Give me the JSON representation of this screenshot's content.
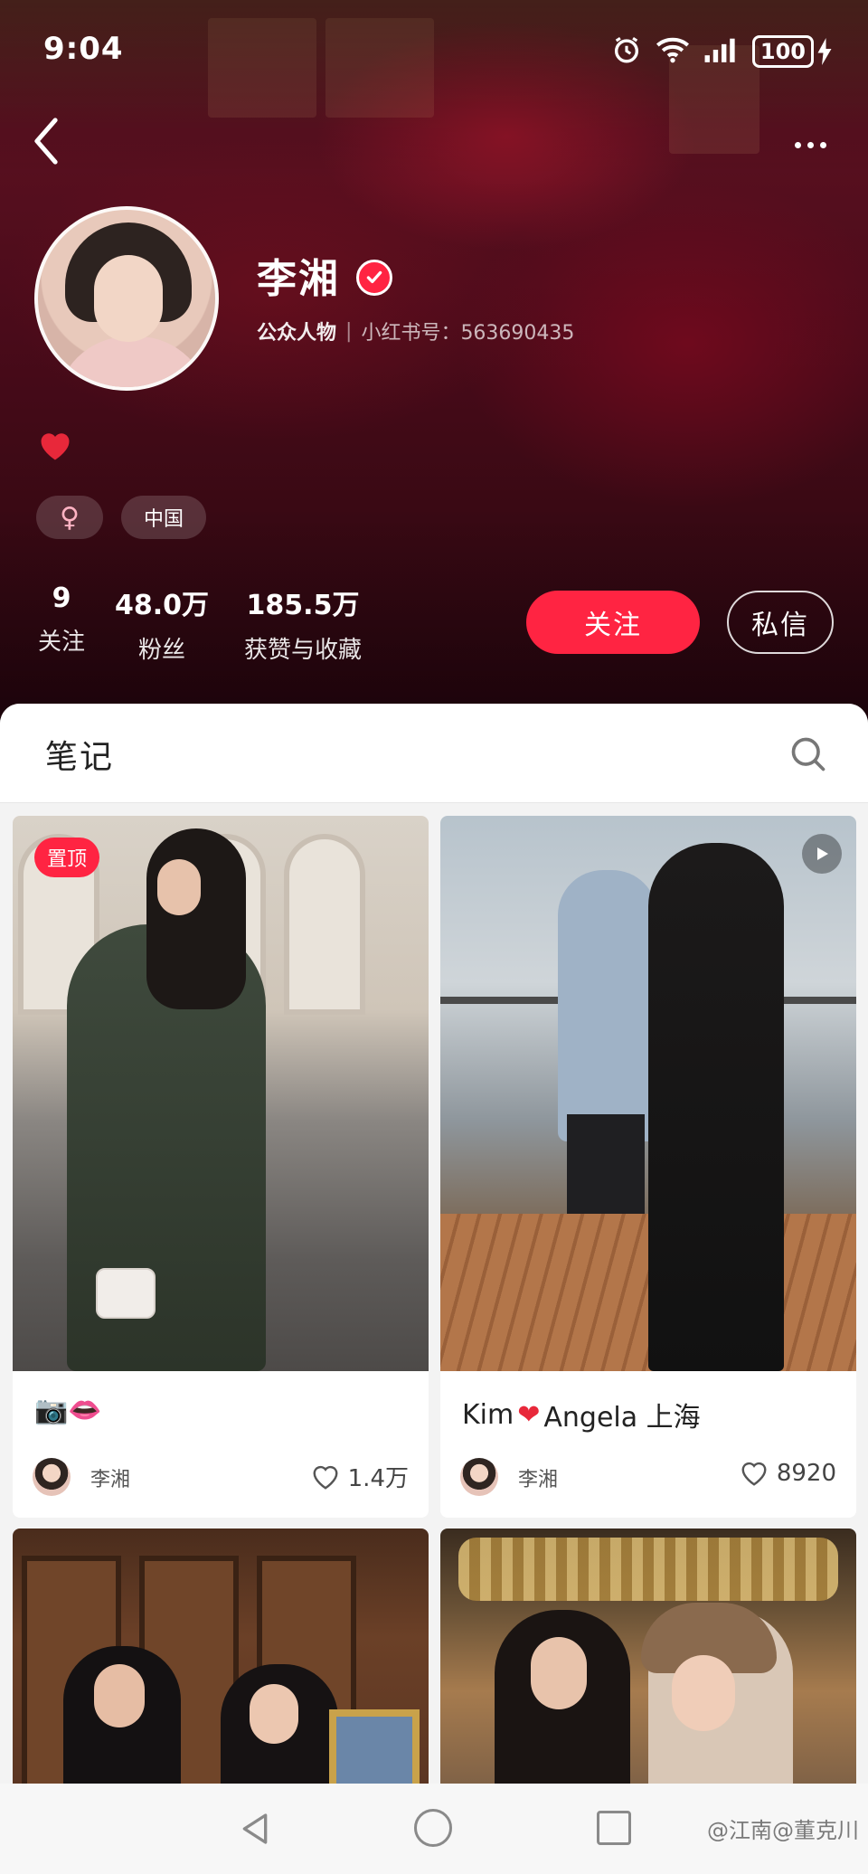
{
  "status_bar": {
    "time": "9:04",
    "battery": "100",
    "icons": [
      "alarm-icon",
      "wifi-icon",
      "signal-icon",
      "battery-icon",
      "charging-icon"
    ]
  },
  "profile": {
    "name": "李湘",
    "role": "公众人物",
    "id_label": "小红书号：563690435",
    "bio_emoji": "❤️",
    "tags": {
      "gender": "♀",
      "region": "中国"
    },
    "stats": {
      "following": {
        "value": "9",
        "label": "关注"
      },
      "fans": {
        "value": "48.0万",
        "label": "粉丝"
      },
      "likes": {
        "value": "185.5万",
        "label": "获赞与收藏"
      }
    },
    "follow_label": "关注",
    "message_label": "私信"
  },
  "colors": {
    "accent": "#ff2442"
  },
  "tabs": {
    "notes": "笔记"
  },
  "notes": [
    {
      "title": "📷👄",
      "author": "李湘",
      "likes": "1.4万",
      "pinned_label": "置顶"
    },
    {
      "title_prefix": "Kim",
      "title_emoji": "❤",
      "title_suffix": "Angela 上海",
      "author": "李湘",
      "likes": "8920",
      "video": true
    },
    {
      "title": "",
      "author": "",
      "likes": ""
    },
    {
      "title": "",
      "author": "",
      "likes": ""
    }
  ],
  "watermark": "@江南@董克川"
}
